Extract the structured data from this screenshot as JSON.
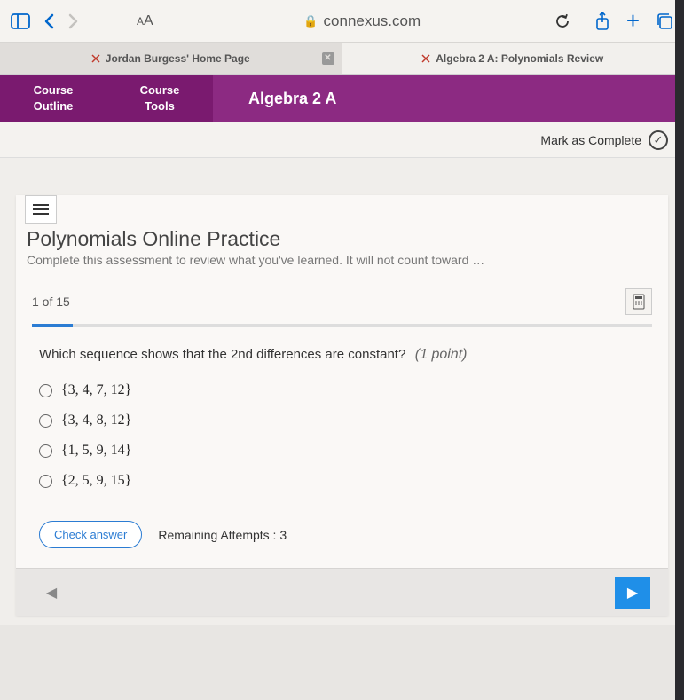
{
  "browser": {
    "url": "connexus.com",
    "aa": "AA"
  },
  "tabs": [
    {
      "label": "Jordan Burgess' Home Page"
    },
    {
      "label": "Algebra 2 A: Polynomials Review"
    }
  ],
  "purpleNav": {
    "outline_l1": "Course",
    "outline_l2": "Outline",
    "tools_l1": "Course",
    "tools_l2": "Tools",
    "title": "Algebra 2 A"
  },
  "markComplete": "Mark as Complete",
  "practice": {
    "title": "Polynomials Online Practice",
    "subtitle": "Complete this assessment to review what you've learned. It will not count toward …"
  },
  "progress": {
    "label": "1 of 15"
  },
  "question": {
    "text": "Which sequence shows that the 2nd differences are constant?",
    "points": "(1 point)",
    "options": [
      "{3, 4, 7, 12}",
      "{3, 4, 8, 12}",
      "{1, 5, 9, 14}",
      "{2, 5, 9, 15}"
    ]
  },
  "checkAnswer": "Check answer",
  "remaining": "Remaining Attempts : 3"
}
